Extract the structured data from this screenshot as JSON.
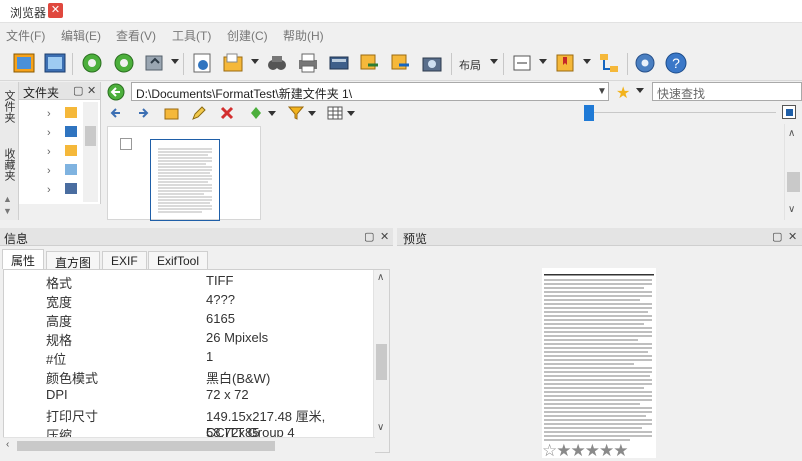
{
  "window": {
    "title": "浏览器"
  },
  "menu": [
    "文件(F)",
    "编辑(E)",
    "查看(V)",
    "工具(T)",
    "创建(C)",
    "帮助(H)"
  ],
  "toolbar": {
    "layout_label": "布局"
  },
  "side_tabs": [
    "文件夹",
    "收藏夹"
  ],
  "folder_panel": {
    "title": "文件夹"
  },
  "address": {
    "path": "D:\\Documents\\FormatTest\\新建文件夹 1\\"
  },
  "search": {
    "placeholder": "快速查找"
  },
  "props_panel": {
    "title": "信息",
    "tabs": [
      "属性",
      "直方图",
      "EXIF",
      "ExifTool"
    ],
    "rows": [
      {
        "key": "格式",
        "value": "TIFF"
      },
      {
        "key": "宽度",
        "value": "4???"
      },
      {
        "key": "高度",
        "value": "6165"
      },
      {
        "key": "规格",
        "value": "26 Mpixels"
      },
      {
        "key": "#位",
        "value": "1"
      },
      {
        "key": "颜色模式",
        "value": "黑白(B&W)"
      },
      {
        "key": "DPI",
        "value": "72 x 72"
      },
      {
        "key": "打印尺寸",
        "value": "149.15x217.48 厘米, 58.72x85"
      },
      {
        "key": "压缩",
        "value": "CCITT Group 4"
      }
    ]
  },
  "preview_panel": {
    "title": "预览",
    "rating_max": 5,
    "rating": 0
  }
}
